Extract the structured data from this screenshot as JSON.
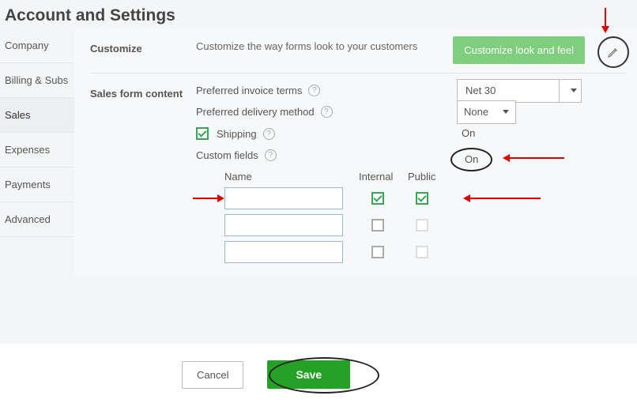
{
  "page_title": "Account and Settings",
  "sidebar": {
    "items": [
      {
        "label": "Company"
      },
      {
        "label": "Billing & Subs"
      },
      {
        "label": "Sales"
      },
      {
        "label": "Expenses"
      },
      {
        "label": "Payments"
      },
      {
        "label": "Advanced"
      }
    ]
  },
  "sections": {
    "customize": {
      "label": "Customize",
      "description": "Customize the way forms look to your customers",
      "button": "Customize look and feel"
    },
    "sales_form": {
      "label": "Sales form content",
      "fields": {
        "invoice_terms": {
          "label": "Preferred invoice terms",
          "value": "Net 30"
        },
        "delivery_method": {
          "label": "Preferred delivery method",
          "value": "None"
        },
        "shipping": {
          "label": "Shipping",
          "status": "On"
        },
        "custom_fields": {
          "label": "Custom fields",
          "status": "On"
        }
      },
      "cf_headers": {
        "name": "Name",
        "internal": "Internal",
        "public": "Public"
      },
      "cf_rows": [
        {
          "name": "",
          "internal": true,
          "public": true
        },
        {
          "name": "",
          "internal": false,
          "public": false
        },
        {
          "name": "",
          "internal": false,
          "public": false
        }
      ]
    }
  },
  "footer": {
    "cancel": "Cancel",
    "save": "Save"
  }
}
